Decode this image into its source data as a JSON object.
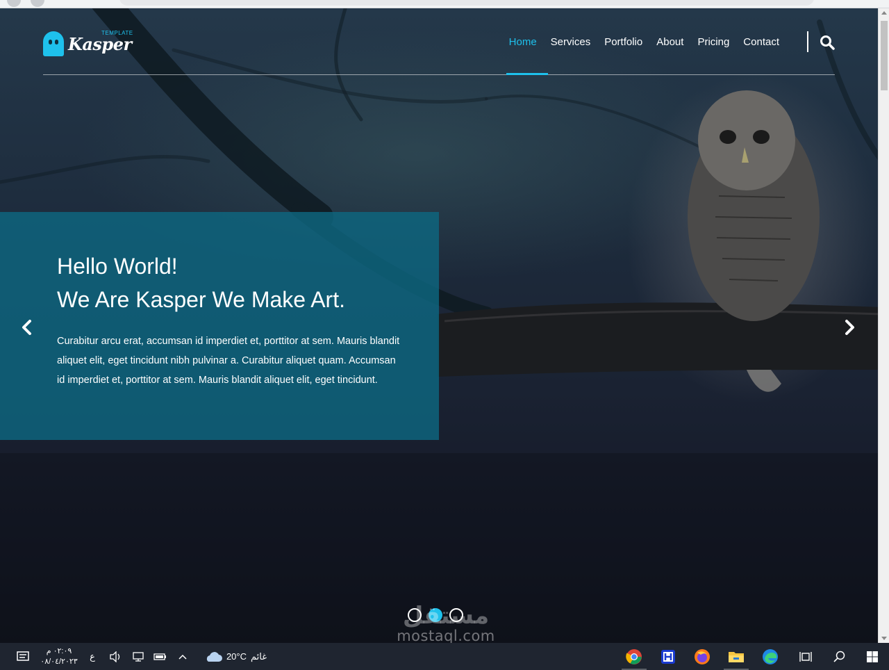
{
  "site": {
    "logo_text": "Kasper",
    "logo_subtext": "TEMPLATE",
    "nav": [
      {
        "label": "Home",
        "active": true
      },
      {
        "label": "Services",
        "active": false
      },
      {
        "label": "Portfolio",
        "active": false
      },
      {
        "label": "About",
        "active": false
      },
      {
        "label": "Pricing",
        "active": false
      },
      {
        "label": "Contact",
        "active": false
      }
    ],
    "search_icon": "search-icon",
    "accent_color": "#1ec1ec"
  },
  "hero": {
    "line1": "Hello World!",
    "line2": "We Are Kasper We Make Art.",
    "paragraph": "Curabitur arcu erat, accumsan id imperdiet et, porttitor at sem. Mauris blandit aliquet elit, eget tincidunt nibh pulvinar a. Curabitur aliquet quam. Accumsan id imperdiet et, porttitor at sem. Mauris blandit aliquet elit, eget tincidunt.",
    "prev_icon": "chevron-left-icon",
    "next_icon": "chevron-right-icon",
    "slides_count": 3,
    "active_slide": 2
  },
  "watermark": {
    "arabic": "مستقل",
    "domain": "mostaql.com"
  },
  "taskbar": {
    "time": "٠٢:٠٩ م",
    "date": "٠٨/٠٤/٢٠٢٣",
    "language": "ع",
    "temperature": "20°C",
    "weather_text": "غائم",
    "apps": [
      "chrome-icon",
      "h-app-icon",
      "firefox-icon",
      "file-explorer-icon",
      "edge-icon",
      "task-view-icon",
      "search-icon",
      "windows-start-icon"
    ]
  }
}
